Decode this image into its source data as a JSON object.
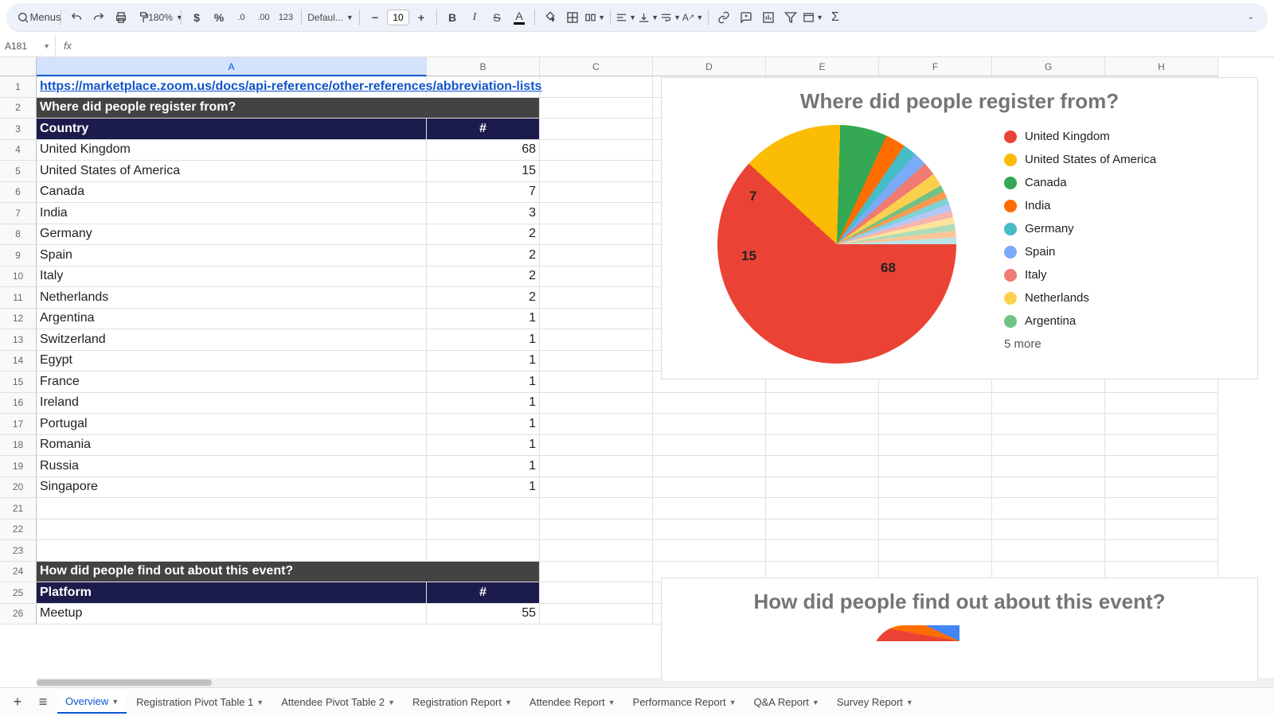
{
  "toolbar": {
    "menus_label": "Menus",
    "zoom": "180%",
    "number123": "123",
    "fontname": "Defaul...",
    "fontsize": "10"
  },
  "namebox": "A181",
  "columns": [
    "A",
    "B",
    "C",
    "D",
    "E",
    "F",
    "G",
    "H"
  ],
  "cells": {
    "link": "https://marketplace.zoom.us/docs/api-reference/other-references/abbreviation-lists",
    "q1_title": "Where did people register from?",
    "hdr_country": "Country",
    "hdr_hash": "#",
    "countries": [
      {
        "name": "United Kingdom",
        "count": "68"
      },
      {
        "name": "United States of America",
        "count": "15"
      },
      {
        "name": "Canada",
        "count": "7"
      },
      {
        "name": "India",
        "count": "3"
      },
      {
        "name": "Germany",
        "count": "2"
      },
      {
        "name": "Spain",
        "count": "2"
      },
      {
        "name": "Italy",
        "count": "2"
      },
      {
        "name": "Netherlands",
        "count": "2"
      },
      {
        "name": "Argentina",
        "count": "1"
      },
      {
        "name": "Switzerland",
        "count": "1"
      },
      {
        "name": "Egypt",
        "count": "1"
      },
      {
        "name": "France",
        "count": "1"
      },
      {
        "name": "Ireland",
        "count": "1"
      },
      {
        "name": "Portugal",
        "count": "1"
      },
      {
        "name": "Romania",
        "count": "1"
      },
      {
        "name": "Russia",
        "count": "1"
      },
      {
        "name": "Singapore",
        "count": "1"
      }
    ],
    "q2_title": "How did people find out about this event?",
    "hdr_platform": "Platform",
    "platforms": [
      {
        "name": "Meetup",
        "count": "55"
      }
    ]
  },
  "chart_data": [
    {
      "type": "pie",
      "title": "Where did people register from?",
      "series": [
        {
          "name": "United Kingdom",
          "value": 68,
          "color": "#ea4335"
        },
        {
          "name": "United States of America",
          "value": 15,
          "color": "#fbbc04"
        },
        {
          "name": "Canada",
          "value": 7,
          "color": "#34a853"
        },
        {
          "name": "India",
          "value": 3,
          "color": "#ff6d01"
        },
        {
          "name": "Germany",
          "value": 2,
          "color": "#46bdc6"
        },
        {
          "name": "Spain",
          "value": 2,
          "color": "#7baaf7"
        },
        {
          "name": "Italy",
          "value": 2,
          "color": "#f07b72"
        },
        {
          "name": "Netherlands",
          "value": 2,
          "color": "#fcd04f"
        },
        {
          "name": "Argentina",
          "value": 1,
          "color": "#71c287"
        },
        {
          "name": "Switzerland",
          "value": 1,
          "color": "#ff994d"
        },
        {
          "name": "Egypt",
          "value": 1,
          "color": "#7ed1d7"
        },
        {
          "name": "France",
          "value": 1,
          "color": "#b3c7f7"
        },
        {
          "name": "Ireland",
          "value": 1,
          "color": "#f7b4ae"
        },
        {
          "name": "Portugal",
          "value": 1,
          "color": "#fde49b"
        },
        {
          "name": "Romania",
          "value": 1,
          "color": "#aedcba"
        },
        {
          "name": "Russia",
          "value": 1,
          "color": "#ffc599"
        },
        {
          "name": "Singapore",
          "value": 1,
          "color": "#b8e4e8"
        }
      ],
      "labels_shown": [
        "68",
        "15",
        "7"
      ],
      "legend_more": "5 more"
    },
    {
      "type": "pie",
      "title": "How did people find out about this event?",
      "series": []
    }
  ],
  "tabs": [
    {
      "label": "Overview",
      "active": true
    },
    {
      "label": "Registration Pivot Table 1"
    },
    {
      "label": "Attendee Pivot Table 2"
    },
    {
      "label": "Registration Report"
    },
    {
      "label": "Attendee Report"
    },
    {
      "label": "Performance Report"
    },
    {
      "label": "Q&A Report"
    },
    {
      "label": "Survey Report"
    }
  ]
}
